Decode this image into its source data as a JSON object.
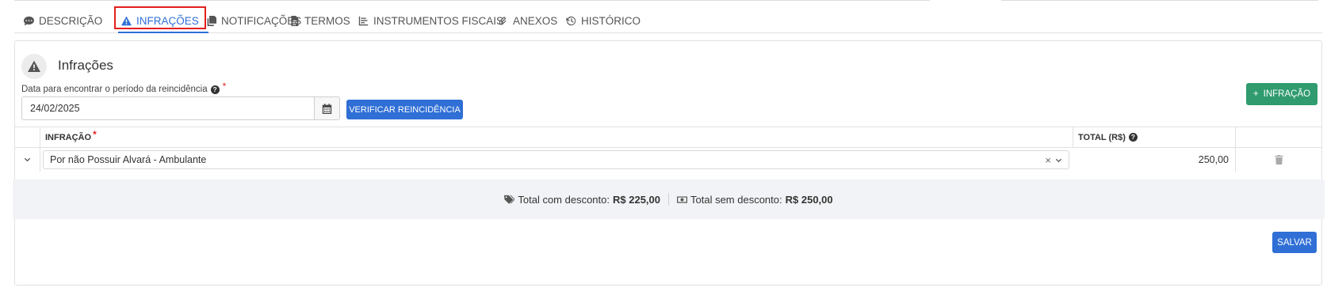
{
  "tabs": [
    {
      "label": "DESCRIÇÃO",
      "icon": "comment-icon"
    },
    {
      "label": "INFRAÇÕES",
      "icon": "warning-icon",
      "active": true
    },
    {
      "label": "NOTIFICAÇÕES",
      "icon": "copy-icon"
    },
    {
      "label": "TERMOS",
      "icon": "file-icon"
    },
    {
      "label": "INSTRUMENTOS FISCAIS",
      "icon": "list-chart-icon"
    },
    {
      "label": "ANEXOS",
      "icon": "paperclip-icon"
    },
    {
      "label": "HISTÓRICO",
      "icon": "history-icon"
    }
  ],
  "section": {
    "title": "Infrações",
    "date_label": "Data para encontrar o período da reincidência",
    "date_value": "24/02/2025",
    "verify_button": "VERIFICAR REINCIDÊNCIA",
    "add_button": "INFRAÇÃO"
  },
  "table": {
    "headers": {
      "infracao": "INFRAÇÃO",
      "total": "TOTAL (R$)"
    },
    "rows": [
      {
        "infracao": "Por não Possuir Alvará - Ambulante",
        "total": "250,00"
      }
    ]
  },
  "totals": {
    "with_discount_label": "Total com desconto:",
    "with_discount_value": "R$ 225,00",
    "without_discount_label": "Total sem desconto:",
    "without_discount_value": "R$ 250,00"
  },
  "save_button": "SALVAR",
  "colors": {
    "accent": "#2f6fd6",
    "success": "#2f9b6e",
    "highlight": "#e41e1e"
  }
}
